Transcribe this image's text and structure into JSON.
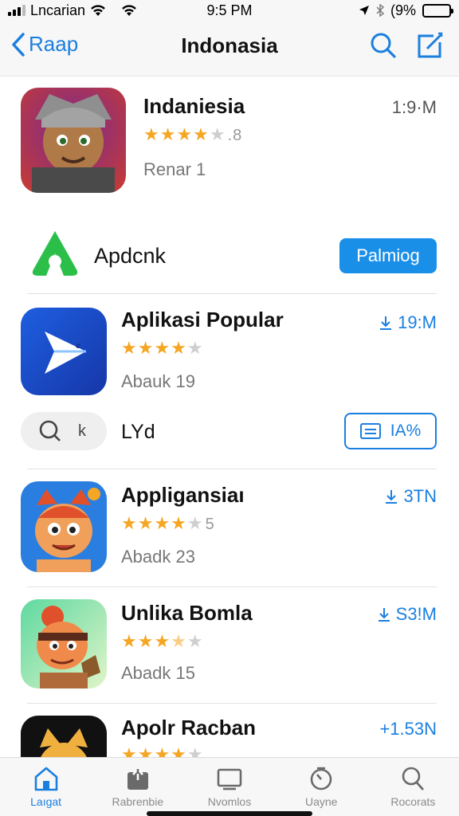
{
  "status_bar": {
    "carrier": "Lncarian",
    "time": "9:5 PM",
    "battery_text": "(9%",
    "battery_level": 0.85,
    "battery_color": "#3bc43b"
  },
  "nav": {
    "back_label": "Raap",
    "title": "Indonasia",
    "search_icon": "search-icon",
    "compose_icon": "compose-icon"
  },
  "featured_app": {
    "name": "Indaniesia",
    "rating_num": ".8",
    "stars": 4,
    "subtitle": "Renar 1",
    "size": "1:9·M"
  },
  "brand": {
    "name": "Apdcnk",
    "button_label": "Palmiog",
    "brand_color": "#2bbf4a"
  },
  "apps": [
    {
      "name": "Aplikasi Popular",
      "stars": 4,
      "rating_num": "",
      "subtitle": "Abauk 19",
      "size": "19:M",
      "size_icon": "download-icon"
    }
  ],
  "filter_row": {
    "search_icon": "search-icon",
    "search_suffix": "k",
    "label": "LYd",
    "button_label": "IA%",
    "button_icon": "list-icon"
  },
  "apps_more": [
    {
      "name": "Appligansiaı",
      "stars": 4,
      "rating_num": "5",
      "subtitle": "Abadk 23",
      "size": "3TN",
      "size_icon": "download-icon"
    },
    {
      "name": "Unlika Bomla",
      "stars": 3.5,
      "rating_num": "",
      "subtitle": "Abadk 15",
      "size": "S3!M",
      "size_icon": "download-icon"
    },
    {
      "name": "Apolr Racban",
      "stars": 4,
      "rating_num": "",
      "subtitle": "",
      "size": "+1.53N",
      "size_icon": ""
    }
  ],
  "tabs": [
    {
      "label": "Laıgat",
      "icon": "home-icon",
      "active": true
    },
    {
      "label": "Rabrenbie",
      "icon": "updates-icon",
      "active": false
    },
    {
      "label": "Nvomlos",
      "icon": "screen-icon",
      "active": false
    },
    {
      "label": "Uayne",
      "icon": "clock-icon",
      "active": false
    },
    {
      "label": "Rocorats",
      "icon": "search-icon",
      "active": false
    }
  ],
  "accent_color": "#1a7fe0",
  "star_color": "#f5a623"
}
